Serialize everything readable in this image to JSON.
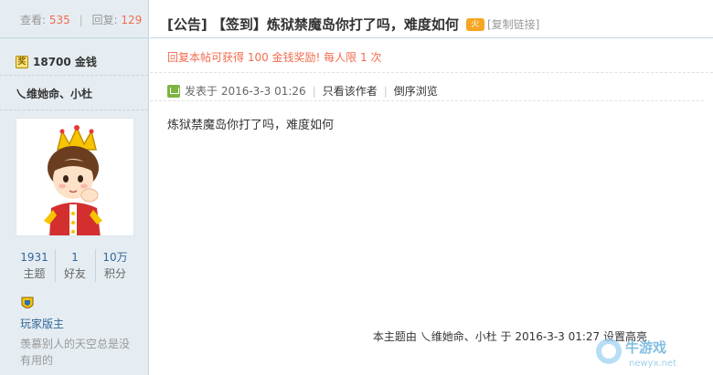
{
  "sidebar": {
    "views_label": "查看:",
    "views_value": "535",
    "replies_label": "回复:",
    "replies_value": "129",
    "gold_icon_text": "奖",
    "gold_text": "18700 金钱",
    "author_name": "乀维她命、小杜",
    "stats": [
      {
        "value": "1931",
        "label": "主题"
      },
      {
        "value": "1",
        "label": "好友"
      },
      {
        "value": "10万",
        "label": "积分"
      }
    ],
    "rank": "玩家版主",
    "signature": "羡慕别人的天空总是没有用的"
  },
  "post": {
    "title": "[公告] 【签到】炼狱禁魔岛你打了吗，难度如何",
    "hot_badge": "火",
    "copy_link": "[复制链接]",
    "reward_notice": "回复本帖可获得 100 金钱奖励! 每人限 1 次",
    "posted_at": "发表于 2016-3-3 01:26",
    "only_author": "只看该作者",
    "reverse_order": "倒序浏览",
    "body": "炼狱禁魔岛你打了吗，难度如何",
    "footer_note": "本主题由 乀维她命、小杜 于 2016-3-3 01:27 设置高亮"
  },
  "watermark": {
    "text": "牛游戏",
    "url": "newyx.net"
  },
  "colors": {
    "accent_red": "#f26c4f",
    "link_blue": "#336699",
    "sidebar_bg": "#e5edf2"
  }
}
